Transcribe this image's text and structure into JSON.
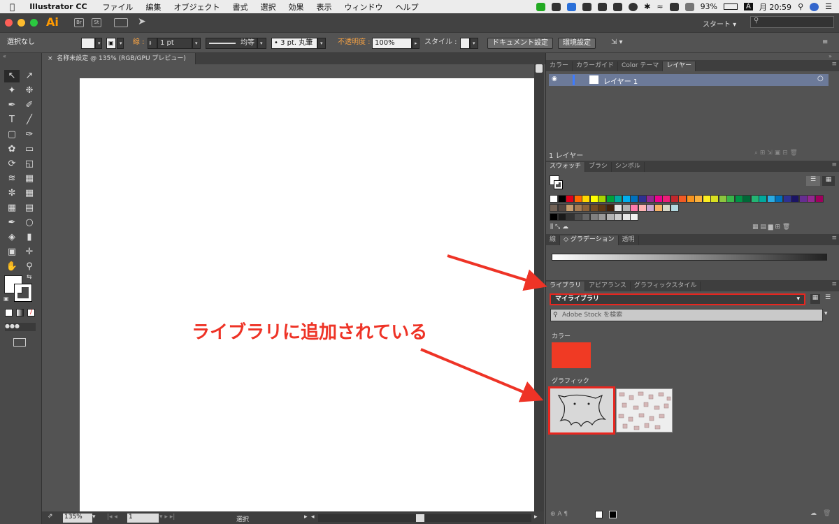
{
  "menubar": {
    "app_name": "Illustrator CC",
    "items": [
      "ファイル",
      "編集",
      "オブジェクト",
      "書式",
      "選択",
      "効果",
      "表示",
      "ウィンドウ",
      "ヘルプ"
    ],
    "battery": "93%",
    "input_indicator": "A",
    "clock": "月 20:59"
  },
  "appbar": {
    "logo": "Ai",
    "icons": [
      "Br",
      "St"
    ],
    "workspace": "スタート",
    "search_placeholder": ""
  },
  "control": {
    "selection": "選択なし",
    "stroke_label": "線 :",
    "stroke_weight": "1 pt",
    "stroke_profile": "均等",
    "brush": "3 pt. 丸筆",
    "opacity_label": "不透明度 :",
    "opacity": "100%",
    "style_label": "スタイル :",
    "doc_settings": "ドキュメント設定",
    "preferences": "環境設定"
  },
  "document": {
    "tab_title": "名称未設定 @ 135% (RGB/GPU プレビュー)",
    "zoom": "135%",
    "page": "1",
    "status": "選択"
  },
  "panels": {
    "color_tabs": [
      "カラー",
      "カラーガイド",
      "Color テーマ",
      "レイヤー"
    ],
    "layer_name": "レイヤー 1",
    "layer_count": "1 レイヤー",
    "swatch_tabs": [
      "スウォッチ",
      "ブラシ",
      "シンボル"
    ],
    "gradient_tabs": [
      "線",
      "グラデーション",
      "透明"
    ],
    "library_tabs": [
      "ライブラリ",
      "アピアランス",
      "グラフィックスタイル"
    ],
    "library_name": "マイライブラリ",
    "library_search_placeholder": "Adobe Stock を検索",
    "section_colors": "カラー",
    "section_graphics": "グラフィック",
    "library_color": "#f03a24"
  },
  "annotation": {
    "text": "ライブラリに追加されている",
    "color": "#ee3326"
  },
  "swatches": {
    "row1": [
      "#ffffff",
      "#000000",
      "#e3001b",
      "#ff6a00",
      "#ffd800",
      "#ffff00",
      "#a8d400",
      "#00a13a",
      "#00a99d",
      "#00aeef",
      "#0071bc",
      "#2e3192",
      "#92278f",
      "#ec008c",
      "#ed1e79",
      "#c1272d",
      "#f15a24",
      "#f7931e",
      "#fbb03b",
      "#fcee21",
      "#d9e021",
      "#8cc63f",
      "#39b54a",
      "#009245",
      "#006837",
      "#22b573",
      "#00a99d",
      "#29abe2",
      "#0071bc",
      "#2e3192",
      "#1b1464",
      "#662d91",
      "#93278f",
      "#9e005d",
      "#d4145a",
      "#ed1e79",
      "#c7b299",
      "#998675"
    ],
    "row2": [
      "#736357",
      "#534741",
      "#c69c6d",
      "#a67c52",
      "#8c6239",
      "#754c24",
      "#603813",
      "#42210b",
      "#e6e6e6",
      "#b3b3b3",
      "#ff7bac",
      "#ffb3b3",
      "#c9a8d0",
      "#f7b267",
      "#d8d8c8",
      "#b3d9e0"
    ],
    "row3": [
      "#000000",
      "#1a1a1a",
      "#333333",
      "#4d4d4d",
      "#666666",
      "#808080",
      "#999999",
      "#b3b3b3",
      "#cccccc",
      "#e6e6e6",
      "#f2f2f2"
    ]
  }
}
